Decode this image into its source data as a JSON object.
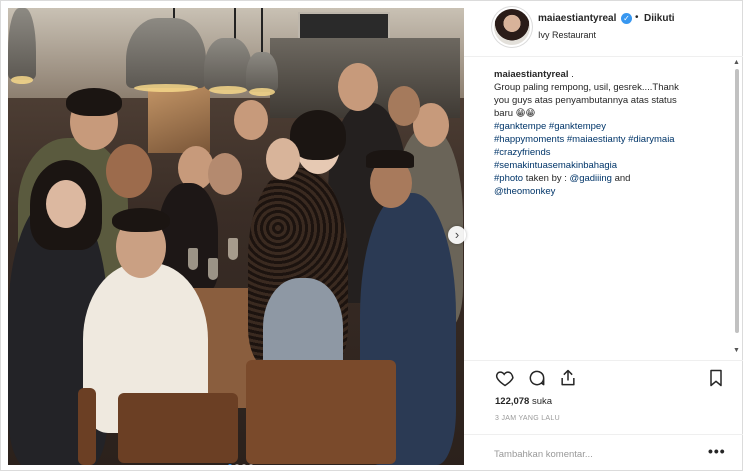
{
  "post": {
    "username": "maiaestiantyreal",
    "verified_icon": "verified-badge-icon",
    "follow_separator": "•",
    "follow_state": "Diikuti",
    "location": "Ivy Restaurant"
  },
  "caption": {
    "username": "maiaestiantyreal",
    "after_user": " .",
    "lines": [
      "Group paling rempong, usil, gesrek....Thank",
      "you guys atas penyambutannya atas status",
      "baru 😁😁"
    ],
    "hashtag_lines": [
      "#ganktempe #ganktempey",
      "#happymoments #maiaestianty #diarymaia",
      "#crazyfriends",
      "#semakintuasemakinbahagia"
    ],
    "photo_line": {
      "tag": "#photo",
      "text": " taken by : ",
      "mention": "@gadiiing",
      "and": " and"
    },
    "mention_line": "@theomonkey"
  },
  "stats": {
    "likes_count": "122,078",
    "likes_label": "suka",
    "time": "3 JAM YANG LALU"
  },
  "comment_box": {
    "placeholder": "Tambahkan komentar...",
    "more": "•••"
  },
  "carousel": {
    "next": "›",
    "slides": 4,
    "active_slide": 1
  },
  "colors": {
    "accent": "#3897f0",
    "link": "#003569",
    "border": "#dbdbdb",
    "muted": "#999999"
  }
}
